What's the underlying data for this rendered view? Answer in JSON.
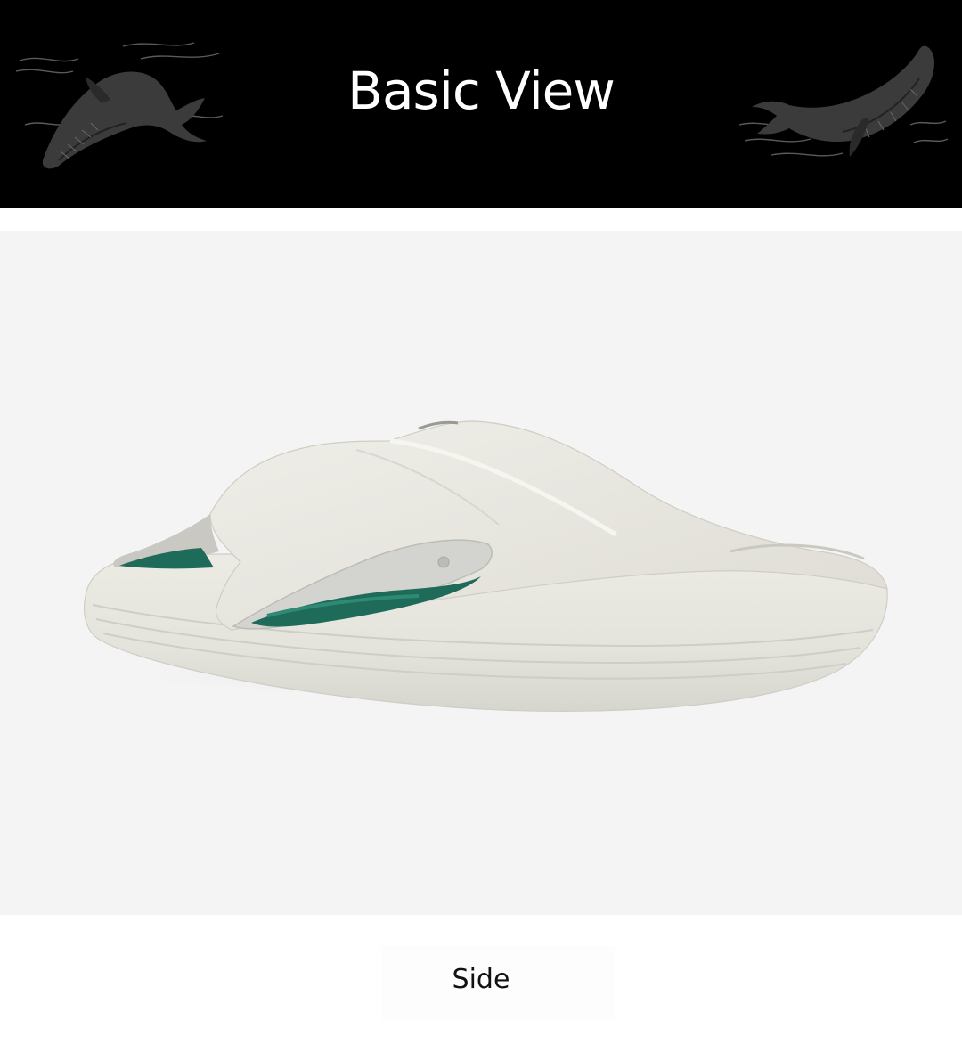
{
  "header": {
    "title": "Basic View"
  },
  "caption": {
    "label": "Side"
  },
  "colors": {
    "banner_background": "#000000",
    "title_text": "#ffffff",
    "photo_background": "#f4f4f4",
    "slide_body": "#e9e8e1",
    "insole_accent": "#1f6b5a"
  },
  "icons": {
    "banner_left_decoration": "whale-icon",
    "banner_right_decoration": "whale-icon"
  }
}
